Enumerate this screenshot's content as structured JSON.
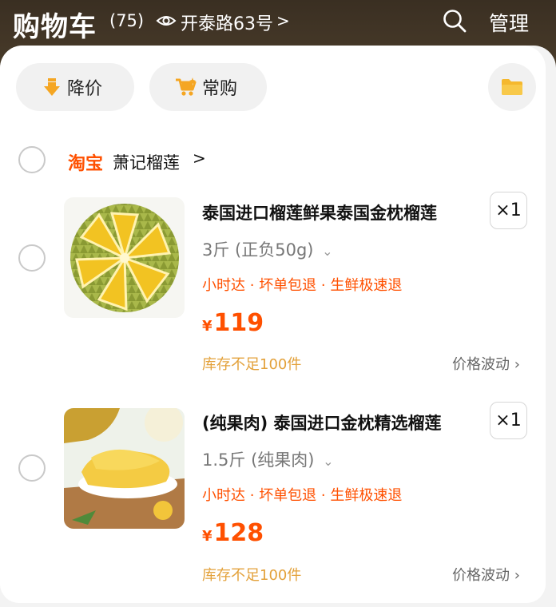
{
  "header": {
    "title": "购物车",
    "count": "(75)",
    "address": "开泰路63号",
    "address_chevron": ">",
    "manage": "管理"
  },
  "chips": {
    "price_drop": "降价",
    "frequent": "常购"
  },
  "shop": {
    "platform": "淘宝",
    "name": "萧记榴莲",
    "chevron": ">"
  },
  "items": [
    {
      "name": "泰国进口榴莲鲜果泰国金枕榴莲",
      "qty": "×1",
      "spec": "3斤 (正负50g)",
      "tags": "小时达 · 坏单包退 · 生鲜极速退",
      "currency": "¥",
      "price": "119",
      "stock": "库存不足100件",
      "fluct": "价格波动"
    },
    {
      "name": "(纯果肉) 泰国进口金枕精选榴莲",
      "qty": "×1",
      "spec": "1.5斤 (纯果肉)",
      "tags": "小时达 · 坏单包退 · 生鲜极速退",
      "currency": "¥",
      "price": "128",
      "stock": "库存不足100件",
      "fluct": "价格波动"
    }
  ],
  "colors": {
    "accent": "#ff5000",
    "stock": "#e3a13a",
    "header_bg": "#3a2f22"
  },
  "icons": {
    "eye": "eye-icon",
    "search": "search-icon",
    "price_drop": "arrow-down-icon",
    "cart": "cart-icon",
    "folder": "folder-icon"
  }
}
